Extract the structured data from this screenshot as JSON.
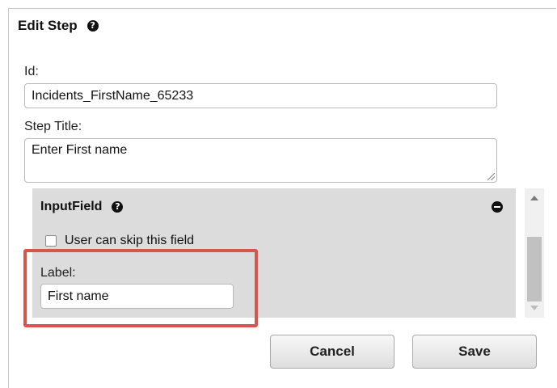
{
  "dialog": {
    "title": "Edit Step",
    "help_icon": "question-circle-icon",
    "id_label": "Id:",
    "id_value": "Incidents_FirstName_65233",
    "step_title_label": "Step Title:",
    "step_title_value": "Enter First name"
  },
  "input_field_panel": {
    "title": "InputField",
    "help_icon": "question-circle-icon",
    "remove_icon": "minus-circle-icon",
    "skip_label": "User can skip this field",
    "skip_checked": false,
    "label_label": "Label:",
    "label_value": "First name"
  },
  "buttons": {
    "cancel": "Cancel",
    "save": "Save"
  },
  "colors": {
    "highlight": "#d9534f",
    "panel_bg": "#dcdcdc"
  }
}
